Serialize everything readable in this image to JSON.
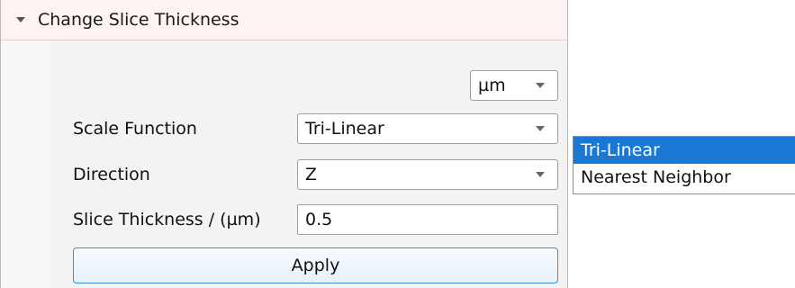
{
  "section": {
    "title": "Change Slice Thickness"
  },
  "unit_combo": {
    "value": "µm"
  },
  "scale_function": {
    "label": "Scale Function",
    "value": "Tri-Linear"
  },
  "direction": {
    "label": "Direction",
    "value": "Z"
  },
  "slice_thickness": {
    "label": "Slice Thickness / (µm)",
    "value": "0.5"
  },
  "apply_button": {
    "label": "Apply"
  },
  "dropdown_popup": {
    "options": [
      "Tri-Linear",
      "Nearest Neighbor"
    ],
    "selected_index": 0
  },
  "colors": {
    "selection": "#1978d3",
    "apply_border": "#3c8fd6",
    "header_background": "#fdf3f3"
  }
}
